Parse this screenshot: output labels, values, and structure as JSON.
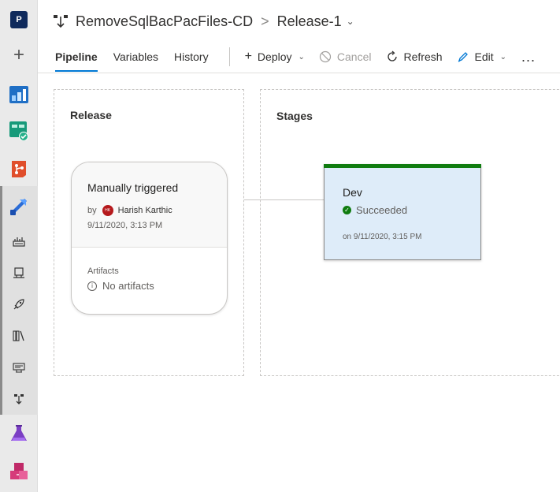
{
  "rail": {
    "org_initial": "P"
  },
  "header": {
    "pipeline_name": "RemoveSqlBacPacFiles-CD",
    "separator": ">",
    "release_name": "Release-1"
  },
  "tabs": [
    {
      "label": "Pipeline",
      "active": true
    },
    {
      "label": "Variables",
      "active": false
    },
    {
      "label": "History",
      "active": false
    }
  ],
  "commands": {
    "deploy": "Deploy",
    "cancel": "Cancel",
    "refresh": "Refresh",
    "edit": "Edit",
    "more": "..."
  },
  "release_panel": {
    "title": "Release",
    "card": {
      "title": "Manually triggered",
      "by_label": "by",
      "user_initials": "HK",
      "user_name": "Harish Karthic",
      "date": "9/11/2020, 3:13 PM",
      "artifacts_label": "Artifacts",
      "artifacts_value": "No artifacts"
    }
  },
  "stages_panel": {
    "title": "Stages",
    "stage": {
      "name": "Dev",
      "status": "Succeeded",
      "completed_on": "on 9/11/2020, 3:15 PM",
      "status_color": "#107c10"
    }
  },
  "colors": {
    "accent": "#0078d4",
    "success": "#107c10",
    "stage_bg": "#deecf9"
  }
}
